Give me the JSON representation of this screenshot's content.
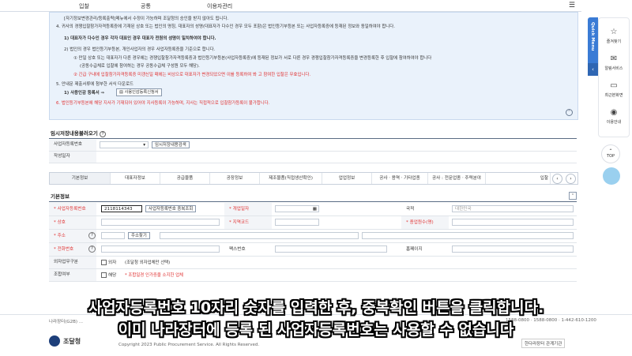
{
  "nav": {
    "items": [
      "입찰",
      "공통",
      "이용자관리"
    ]
  },
  "notice": {
    "lines": [
      "[자기정보변경관리/등록출력]메뉴에서 수정이 가능하며 조달청의 승인을 받지 않아도 됩니다.",
      "4. 귀사의 경쟁입찰참가자격등록증에 기재된 상호 또는 법인의 명칭, 대표자의 성명(대표자가 다수인 경우 모두 포함)은 법인등기부등본 또는 사업자등록증에 등재된 정보와 동일하여야 합니다.",
      "1) 대표자가 다수인 경우 각자 대표인 경우 대표자 전원의 성명이 일치하여야 합니다.",
      "2) 법인의 경우 법인등기부등본, 개인사업자의 경우 사업자등록증을 기준으로 합니다.",
      "① 만일 상호 또는 대표자가 다른 경우에는 경쟁입찰참가자격등록증과 법인등기부등본(사업자등록증)에 등재된 정보가 서로 다른 경우 경쟁입찰참가자격등록증을 변경등록한 후 입찰에 참여하여야 합니다",
      "(공동수급체로 입찰에 참여하는 경우 공동수급체 구성원 모두 해당).",
      "② 긴급 구내에 입찰참가자격등록증 미갱신일 때에는 비상으로 대표자가 변경되었으면 이를 등록하여 봐 고 참여한 입찰은 무효입니다.",
      "5. 안내문 제출서류에 첨부한 서식 다운로드",
      "1) 사용인감 등록서 ⇒",
      "6. 법인등기부등본에 해당 지사가 기재되어 있어야 지사등록이 가능하며, 지사는 직접적으로 입찰참가등록이 불가합니다."
    ],
    "download_button": "사용인감등록신청서"
  },
  "temp_section": {
    "title": "임시저장내용불러오기",
    "label_no": "사업자등록번호",
    "load_button": "임시저장내용검색",
    "label_date": "작성일자"
  },
  "tabs": [
    "기본정보",
    "대표자정보",
    "공급물품",
    "공장정보",
    "제조물품(직접생산확인)",
    "업업정보",
    "공사ㆍ용역ㆍ기타업종",
    "공사 : 전문업종ㆍ주력분야",
    "입찰"
  ],
  "basic": {
    "title": "기본정보",
    "bizno_label": "* 사업자등록번호",
    "bizno_value": "2118114343",
    "dup_button": "사업자등록번호 중복조회",
    "open_date_label": "* 개업일자",
    "country_label": "국적",
    "country_value": "대한민국",
    "name_label": "* 상호",
    "region_label": "* 지역코드",
    "employees_label": "* 종업원수(명)",
    "address_label": "* 주소",
    "address_button": "주소찾기",
    "phone_label": "* 전화번호",
    "fax_label": "팩스번호",
    "homepage_label": "홈페이지",
    "foreign_label": "외자업무구분",
    "foreign_check": "외자",
    "foreign_note": "(조달청 외자업체만 선택)",
    "union_label": "조합여부",
    "union_check": "해당",
    "union_note": "* 조합일경 인가증을 소지한 업체"
  },
  "quick_menu": {
    "tab_label": "Quick Menu"
  },
  "right_bar": [
    "즐겨찾기",
    "알림서비스",
    "최근본화면",
    "이용안내"
  ],
  "top_label": "TOP",
  "footer": {
    "address": "나라장터(G2B) ...",
    "copyright": "Copyright 2023 Public Procurement Service. All Rights Reserved.",
    "phone": "1588-0800 · 1588-0800 · 1-442-610-1200",
    "org": "조달청",
    "right_text": "한다라장터 관계기관"
  },
  "subtitles": [
    "사업자등록번호 10자리 숫자를 입력한 후, 중복확인 버튼을 클릭합니다.",
    "이미 나라장터에 등록 된 사업자등록번호는 사용할 수 없습니다"
  ]
}
